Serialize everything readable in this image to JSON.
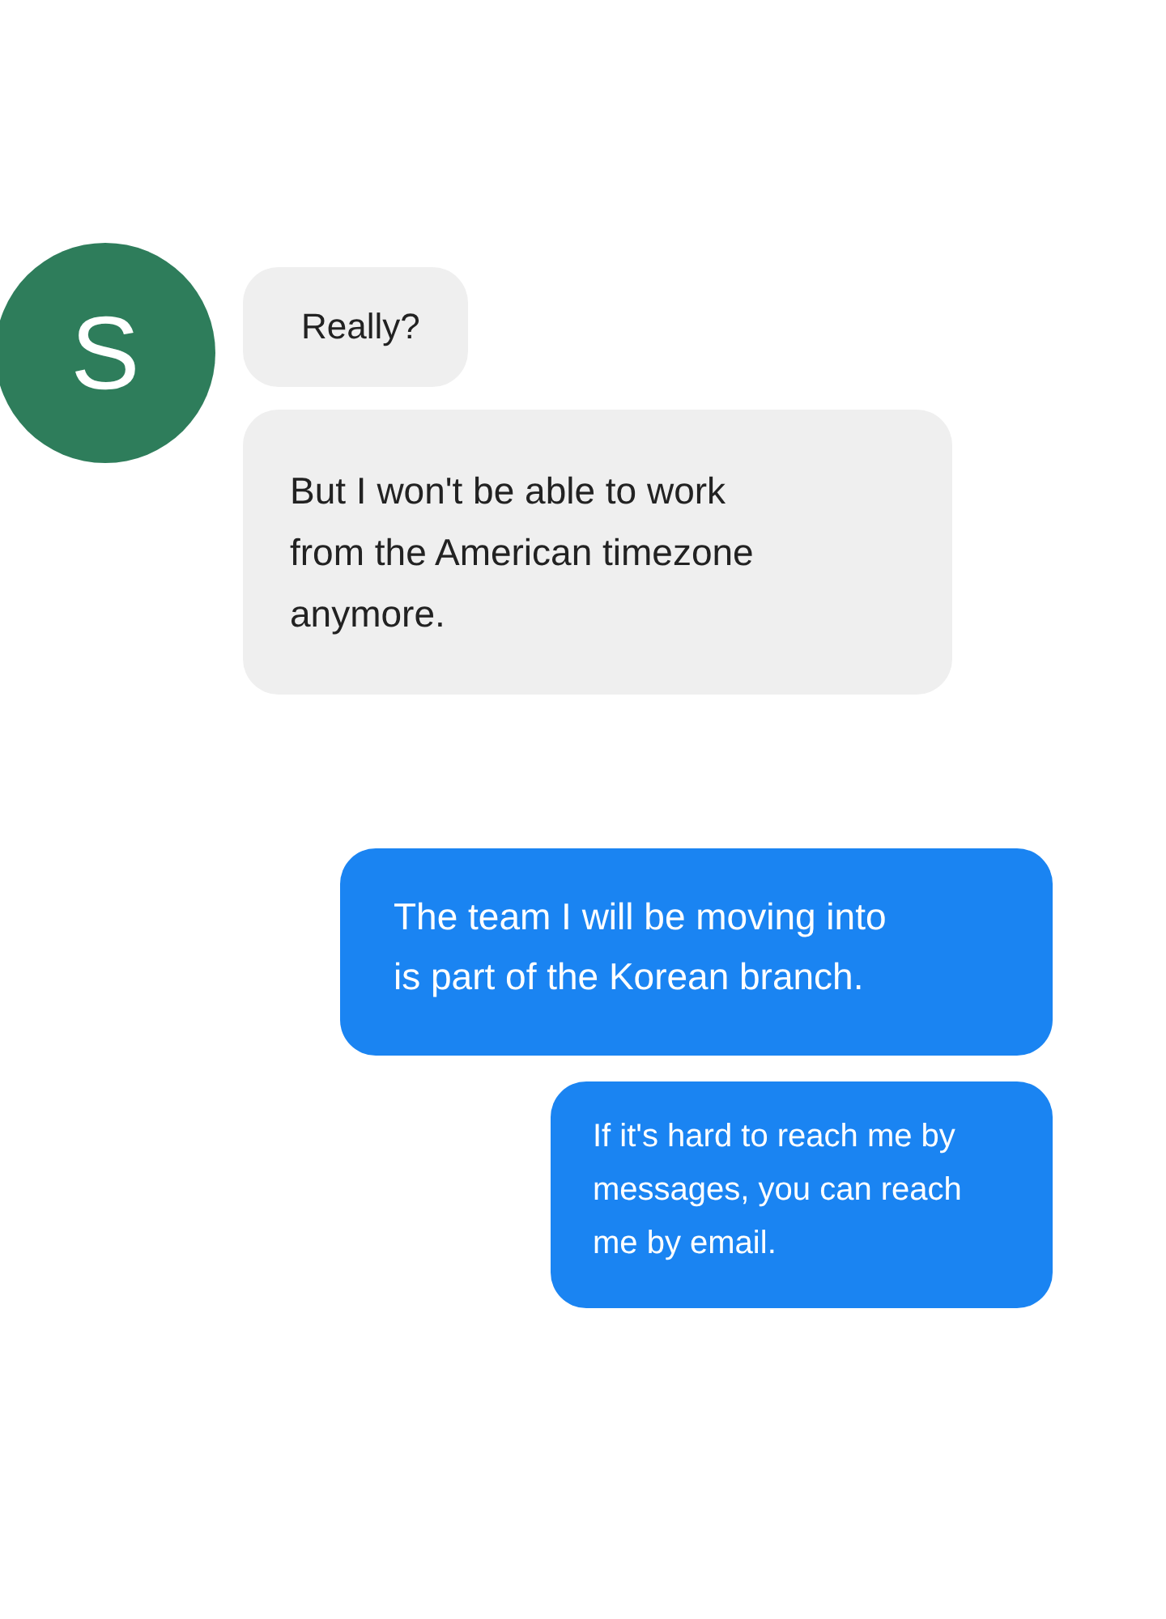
{
  "contact": {
    "initial": "S",
    "color": "#2e7d5b"
  },
  "messages": [
    {
      "kind": "received",
      "lines": [
        "Really?"
      ]
    },
    {
      "kind": "received",
      "lines": [
        "But I won't be able to work",
        "from the American timezone",
        "anymore."
      ]
    },
    {
      "kind": "sent",
      "lines": [
        "The team I will be moving into",
        "is part of the Korean branch."
      ]
    },
    {
      "kind": "sent",
      "lines": [
        "If it's hard to reach me by",
        "messages, you can reach",
        "me by email."
      ]
    }
  ]
}
